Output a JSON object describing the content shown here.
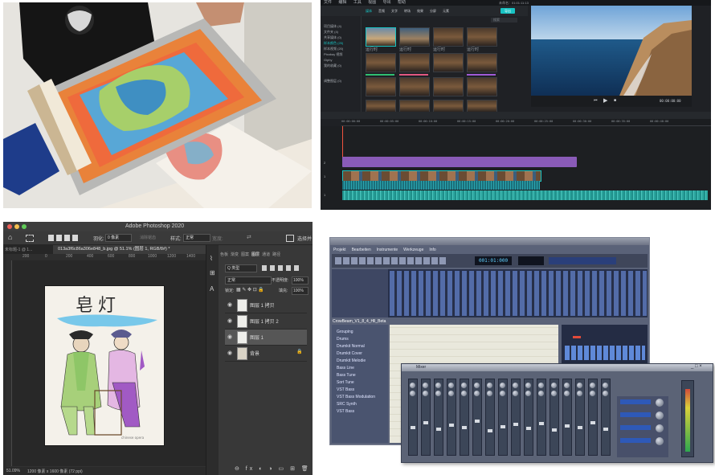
{
  "photo": {
    "description_tag": "screen-printing"
  },
  "video_editor": {
    "menu": [
      "文件",
      "编辑",
      "工具",
      "视图",
      "导出",
      "帮助"
    ],
    "project_name": "未命名：01:01:11:13",
    "export_label": "导出",
    "tabs": [
      "媒体",
      "音频",
      "文字",
      "转场",
      "效果",
      "分屏",
      "元素"
    ],
    "sidebar_items": [
      "项目媒体 (4)",
      "文件夹 (4)",
      "共享媒体 (0)",
      "样本颜色 (25)",
      "样本视频 (20)",
      "Pixabay 视频",
      "Giphy",
      "我的收藏 (0)"
    ],
    "sidebar_footer": "调整图层 (0)",
    "search_placeholder": "搜索",
    "clip_label": "运行时",
    "timecode": "00:00:00:00",
    "ruler": [
      "00:00:00:00",
      "00:00:05:00",
      "00:00:10:00",
      "00:00:15:00",
      "00:00:20:00",
      "00:00:25:00",
      "00:00:30:00",
      "00:00:35:00",
      "00:00:40:00"
    ],
    "tracks": [
      "2",
      "1",
      "1"
    ]
  },
  "photoshop": {
    "app_title": "Adobe Photoshop 2020",
    "tabs": [
      "未标题-1 @ 1...",
      "013a3f6c86a306e848_b.jpg @ 51.1% (图层 1, RGB/8#) *"
    ],
    "options": {
      "feather_label": "羽化:",
      "feather_value": "0 像素",
      "antialias": "消除锯齿",
      "style_label": "样式:",
      "style_value": "正常",
      "width_label": "宽度:",
      "select_subject": "选择并"
    },
    "ruler_h": [
      "200",
      "0",
      "200",
      "400",
      "600",
      "800",
      "1000",
      "1200",
      "1400"
    ],
    "ruler_v": [
      "2",
      "0",
      "0",
      "2",
      "0",
      "0",
      "4",
      "0",
      "0",
      "6",
      "0",
      "0",
      "8",
      "0",
      "0",
      "1",
      "0",
      "0",
      "0",
      "1",
      "2",
      "0",
      "0",
      "1",
      "4",
      "0",
      "0",
      "1",
      "6",
      "0"
    ],
    "panel_tabs": [
      "色板",
      "渐变",
      "图案",
      "图层",
      "通道",
      "路径"
    ],
    "kind_label": "Q 类型",
    "blend_mode": "正常",
    "opacity_label": "不透明度:",
    "opacity_value": "100%",
    "lock_label": "锁定:",
    "fill_label": "填充:",
    "fill_value": "100%",
    "layers": [
      "图层 1 拷贝",
      "图层 1 拷贝 2",
      "图层 1",
      "背景"
    ],
    "artwork_title": "皂灯",
    "status": "51.09%",
    "status_doc": "1200 像素 x 1600 像素 (72 ppi)"
  },
  "daw": {
    "menu": [
      "Projekt",
      "Bearbeiten",
      "Instrumente",
      "Werkzeuge",
      "Info"
    ],
    "tracks": [
      "Grouping",
      "Drums",
      "Drumkit Normal",
      "Drumkit Cover",
      "Drumkit Melodie",
      "Bass Line",
      "Bass Tune",
      "Sort Tune",
      "VST Bass",
      "VST Bass Modulation",
      "SRC Synth",
      "VST Bass"
    ],
    "arranger_title": "CrowBeam_V1_8_4_Hll_Beta",
    "mixer_title": "Mixer"
  }
}
